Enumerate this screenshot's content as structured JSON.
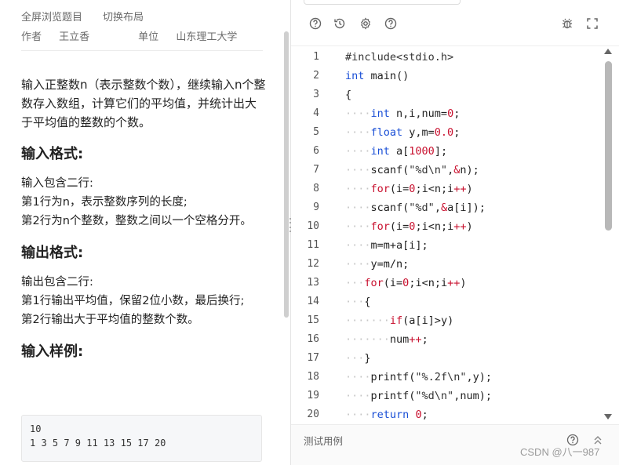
{
  "problem": {
    "meta": {
      "fullscreen": "全屏浏览题目",
      "switch_layout": "切换布局",
      "author_label": "作者",
      "author": "王立香",
      "unit_label": "单位",
      "unit": "山东理工大学"
    },
    "description": "输入正整数n（表示整数个数），继续输入n个整数存入数组，计算它们的平均值，并统计出大于平均值的整数的个数。",
    "input_format_title": "输入格式:",
    "input_format_body": [
      "输入包含二行:",
      "第1行为n，表示整数序列的长度;",
      "第2行为n个整数，整数之间以一个空格分开。"
    ],
    "output_format_title": "输出格式:",
    "output_format_body": [
      "输出包含二行:",
      "第1行输出平均值，保留2位小数，最后换行;",
      "第2行输出大于平均值的整数个数。"
    ],
    "sample_title": "输入样例:",
    "sample_lines": [
      "10",
      "1 3 5 7 9 11 13 15 17 20"
    ]
  },
  "editor": {
    "toolbar_icons": [
      "help-circle-icon",
      "history-icon",
      "gear-icon",
      "question-icon",
      "bug-icon",
      "fullscreen-icon"
    ],
    "line_numbers": [
      "1",
      "2",
      "3",
      "4",
      "5",
      "6",
      "7",
      "8",
      "9",
      "10",
      "11",
      "12",
      "13",
      "14",
      "15",
      "16",
      "17",
      "18",
      "19",
      "20"
    ],
    "code_lines": [
      "#include<stdio.h>",
      "int main()",
      "{",
      "int n,i,num=0;",
      "float y,m=0.0;",
      "int a[1000];",
      "scanf(\"%d\\n\",&n);",
      "for(i=0;i<n;i++)",
      "scanf(\"%d\",&a[i]);",
      "for(i=0;i<n;i++)",
      "m=m+a[i];",
      "y=m/n;",
      "for(i=0;i<n;i++)",
      "{",
      "if(a[i]>y)",
      "num++;",
      "}",
      "printf(\"%.2f\\n\",y);",
      "printf(\"%d\\n\",num);",
      "return 0;"
    ]
  },
  "bottom": {
    "test_cases_label": "测试用例"
  },
  "watermark": "CSDN @八一987"
}
